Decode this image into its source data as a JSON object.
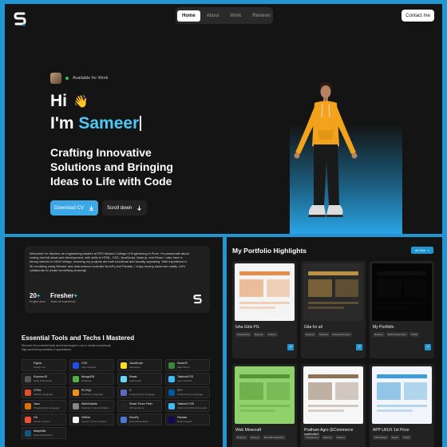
{
  "colors": {
    "accent": "#2196d3",
    "name_highlight": "#4cc9f5",
    "panel": "#141414",
    "available_dot": "#22c55e"
  },
  "nav": {
    "items": [
      {
        "label": "Home",
        "active": true
      },
      {
        "label": "About",
        "active": false
      },
      {
        "label": "Work",
        "active": false
      },
      {
        "label": "Reviews",
        "active": false
      }
    ],
    "contact_label": "Contact me",
    "logo_icon": "s-logo-icon"
  },
  "hero": {
    "availability": "Available for Work",
    "greeting": "Hi",
    "wave_icon": "waving-hand-icon",
    "name_prefix": "I'm ",
    "name": "Sameer",
    "tagline": "Crafting Innovative Solutions and Bringing Ideas to Life with Code",
    "cv_button": "Download CV",
    "scroll_button": "Scroll down"
  },
  "about": {
    "text": "Welcome! I'm Sameer, an engineering student at PES Modern College of Engineering in Pune. I'm passionate about coding and full-stack web development, with skills in HTML, CSS, JavaScript, Node.js, and React. I also have a strong interest in UI/UX design, ensuring my projects are both functional and visually appealing. With experience in 3D modeling using Blender and data science tools like NumPy and Pandas, I enjoy turning ideas into reality. Let's collaborate to create something amazing!",
    "stats": [
      {
        "value": "20",
        "suffix": "+",
        "label": "Project done"
      },
      {
        "value": "Fresher",
        "suffix": "+",
        "label": "Years of experience"
      }
    ]
  },
  "tools": {
    "title": "Essential Tools and Techs I Mastered",
    "subtitle": "Discover the powerful tools and technologies I use to create exceptional, high-performing websites & applications.",
    "items": [
      {
        "name": "Figma",
        "desc": "Design tool",
        "color": "#1e1e1e",
        "icon": "figma-icon"
      },
      {
        "name": "CSS",
        "desc": "User Interface",
        "color": "#264de4",
        "icon": "css-icon"
      },
      {
        "name": "JavaScript",
        "desc": "Interaction",
        "color": "#f7df1e",
        "icon": "javascript-icon"
      },
      {
        "name": "NodeJS",
        "desc": "Web Server",
        "color": "#3c873a",
        "icon": "nodejs-icon"
      },
      {
        "name": "ExpressJS",
        "desc": "Node Framework",
        "color": "#555555",
        "icon": "expressjs-icon"
      },
      {
        "name": "MongoDB",
        "desc": "Database",
        "color": "#4db33d",
        "icon": "mongodb-icon"
      },
      {
        "name": "React",
        "desc": "Framework",
        "color": "#61dafb",
        "icon": "react-icon"
      },
      {
        "name": "TailwindCSS",
        "desc": "User Interface",
        "color": "#38bdf8",
        "icon": "tailwindcss-icon"
      },
      {
        "name": "HTML",
        "desc": "Markup Language",
        "color": "#e34c26",
        "icon": "html-icon"
      },
      {
        "name": "PL/SQL",
        "desc": "Database Language",
        "color": "#f29111",
        "icon": "plsql-icon"
      },
      {
        "name": "C",
        "desc": "Programming Language",
        "color": "#5c6bc0",
        "icon": "c-icon"
      },
      {
        "name": "C++",
        "desc": "Programming Language",
        "color": "#00599c",
        "icon": "cpp-icon"
      },
      {
        "name": "Java",
        "desc": "Programming Language",
        "color": "#e76f00",
        "icon": "java-icon"
      },
      {
        "name": "WebSockets",
        "desc": "Real-time Communication",
        "color": "#888888",
        "icon": "websockets-icon"
      },
      {
        "name": "React Three Fiber",
        "desc": "3D Rendering",
        "color": "#222222",
        "icon": "react-three-fiber-icon"
      },
      {
        "name": "Tailwind CSS",
        "desc": "Utility-First CSS Framework",
        "color": "#38bdf8",
        "icon": "tailwind-css-icon"
      },
      {
        "name": "Git",
        "desc": "Version Control",
        "color": "#f05032",
        "icon": "git-icon"
      },
      {
        "name": "GitHub",
        "desc": "Version Control Hosting",
        "color": "#f5f5f5",
        "icon": "github-icon"
      },
      {
        "name": "NumPy",
        "desc": "Data Manipulation",
        "color": "#4d77cf",
        "icon": "numpy-icon"
      },
      {
        "name": "Pandas",
        "desc": "Data Analysis",
        "color": "#150458",
        "icon": "pandas-icon"
      },
      {
        "name": "Matplotlib",
        "desc": "Data Visualization",
        "color": "#11557c",
        "icon": "matplotlib-icon"
      }
    ]
  },
  "portfolio": {
    "title": "My Portfolio Highlights",
    "view_more": "All View",
    "projects": [
      {
        "name": "Isha Girls PG",
        "tags": [
          "Freelancing",
          "React.js",
          "Node.js"
        ],
        "thumb_bg": "#f4f4f4",
        "thumb_accent": "#e27a2c"
      },
      {
        "name": "Gita for all",
        "tags": [
          "React.js",
          "Tailwind",
          "Personal Project"
        ],
        "thumb_bg": "#2a2a2a",
        "thumb_accent": "#d6a24a"
      },
      {
        "name": "My Portfolio",
        "tags": [
          "React.js",
          "React three Fiber",
          "GSAP"
        ],
        "thumb_bg": "#050505",
        "thumb_accent": "#111111"
      },
      {
        "name": "Web Minecraft",
        "tags": [
          "React.js",
          "Three.js",
          "Mini 3D integration"
        ],
        "thumb_bg": "#8fd16a",
        "thumb_accent": "#4a8c2b"
      },
      {
        "name": "Pratham Agro (ECommerce website)",
        "tags": [
          "Freelancing",
          "React.js",
          "Node.js"
        ],
        "thumb_bg": "#f7f7f7",
        "thumb_accent": "#7a5a3a"
      },
      {
        "name": "APP UI/UX 1st Prize",
        "tags": [
          "APP design",
          "Figma",
          "UI/UX"
        ],
        "thumb_bg": "#f2f5fb",
        "thumb_accent": "#1f8ccf"
      }
    ]
  }
}
